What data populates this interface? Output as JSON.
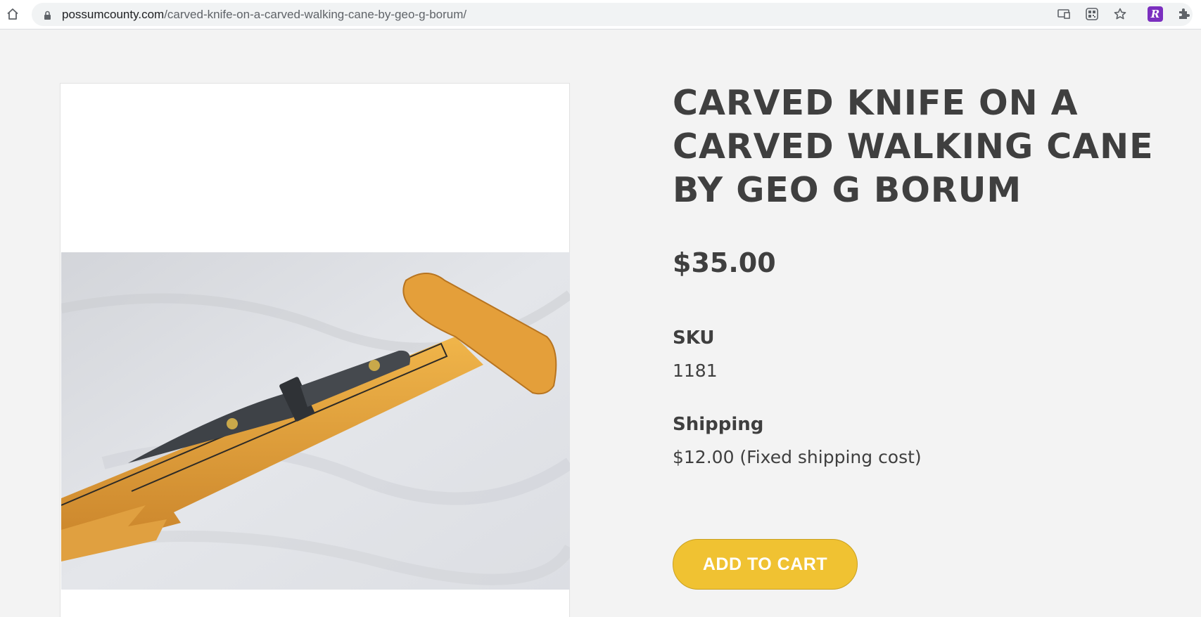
{
  "browser": {
    "url_host": "possumcounty.com",
    "url_path": "/carved-knife-on-a-carved-walking-cane-by-geo-g-borum/",
    "icons": [
      "home-icon",
      "lock-icon",
      "cast-icon",
      "qr-code-icon",
      "bookmark-star-icon",
      "extension-r-icon",
      "puzzle-icon"
    ],
    "extension_letter": "R",
    "extension_color": "#7b2fbf"
  },
  "product": {
    "title": "CARVED KNIFE ON A CARVED WALKING CANE BY GEO G BORUM",
    "price": "$35.00",
    "sku_label": "SKU",
    "sku_value": "1181",
    "shipping_label": "Shipping",
    "shipping_value": "$12.00 (Fixed shipping cost)",
    "add_to_cart_label": "ADD TO CART",
    "accent_color": "#f0c232"
  }
}
